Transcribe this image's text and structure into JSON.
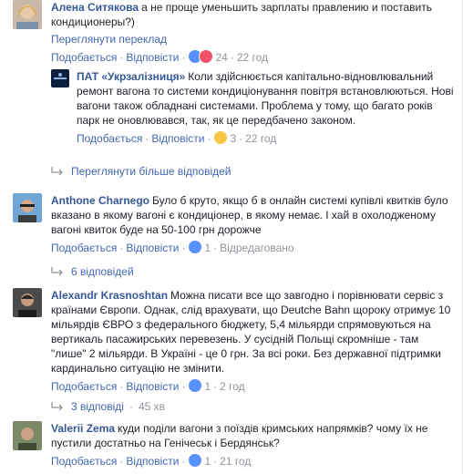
{
  "comments": [
    {
      "name": "Алена Ситякова",
      "text": "а не проще уменьшить зарплаты правлению и поставить кондиционеры?)",
      "translate": "Переглянути переклад",
      "like": "Подобається",
      "reply": "Відповісти",
      "reactions": "24",
      "time": "22 год"
    },
    {
      "name": "ПАТ «Укрзалізниця»",
      "text": "Коли здійснюється капітально-відновлювальний ремонт вагона то системи кондиціонування повітря встановлюються. Нові вагони також обладнані системами. Проблема у тому, що багато років парк не оновлювався, так, як це передбачено законом.",
      "like": "Подобається",
      "reply": "Відповісти",
      "reactions": "3",
      "time": "22 год"
    },
    {
      "name": "Anthone Charnego",
      "text": "Було б круто, якщо б в онлайн системі купівлі квитків було вказано в якому вагоні є кондиціонер, в якому немає. І хай в охолодженому вагоні квиток буде на 50-100 грн дорожче",
      "like": "Подобається",
      "reply": "Відповісти",
      "reactions": "1",
      "edited": "Відредаговано"
    },
    {
      "name": "Alexandr Krasnoshtan",
      "text": "Можна писати все що завгодно і порівнювати сервіс з країнами Європи. Однак, слід врахувати, що Deutche Bahn щороку отримує 10 мільярдів ЄВРО з федерального бюджету, 5,4 мільярди спрямовуються на вертикаль пасажирських перевезень. У сусідній Польщі скромніше - там \"лише\" 2 мільярди. В Україні - це 0 грн. За всі роки. Без державної підтримки кардинально ситуацію не змінити.",
      "like": "Подобається",
      "reply": "Відповісти",
      "reactions": "1",
      "time": "2 год"
    },
    {
      "name": "Valerii Zema",
      "text": "куди поділи вагони з поїздів кримських напрямків? чому їх не пустили достатньо на Генічеськ і Бердянськ?",
      "like": "Подобається",
      "reply": "Відповісти",
      "reactions": "1",
      "time": "21 год"
    }
  ],
  "more_replies": "Переглянути більше відповідей",
  "replies_6": "6 відповідей",
  "replies_3": "3 відповіді",
  "replies_3_time": "45 хв",
  "colors": {
    "link": "#365899",
    "action": "#4267b2",
    "meta": "#90949c",
    "text": "#1d2129"
  }
}
